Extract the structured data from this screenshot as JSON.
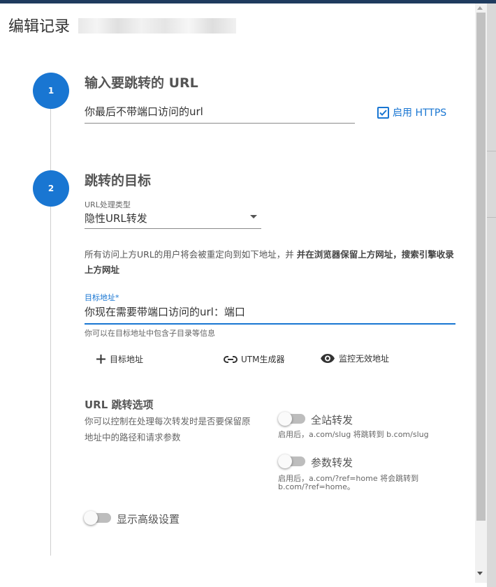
{
  "dialog": {
    "title": "编辑记录"
  },
  "step1": {
    "number": "1",
    "title": "输入要跳转的 URL",
    "url_value": "你最后不带端口访问的url",
    "https_label": "启用 HTTPS",
    "https_checked": true
  },
  "step2": {
    "number": "2",
    "title": "跳转的目标",
    "type_label": "URL处理类型",
    "type_value": "隐性URL转发",
    "description_plain": "所有访问上方URL的用户将会被重定向到如下地址，并 ",
    "description_bold": "并在浏览器保留上方网址，搜索引擎收录上方网址",
    "target_label": "目标地址*",
    "target_value": "你现在需要带端口访问的url：端口",
    "target_hint": "你可以在目标地址中包含子目录等信息",
    "actions": {
      "add_target": "目标地址",
      "utm_builder": "UTM生成器",
      "monitor_invalid": "监控无效地址"
    },
    "options": {
      "title": "URL 跳转选项",
      "description": "你可以控制在处理每次转发时是否要保留原地址中的路径和请求参数",
      "site_forward": {
        "label": "全站转发",
        "hint": "启用后，a.com/slug 将跳转到 b.com/slug",
        "enabled": false
      },
      "param_forward": {
        "label": "参数转发",
        "hint_line1": "启用后，a.com/?ref=home 将会跳转到",
        "hint_line2": "b.com/?ref=home。",
        "enabled": false
      }
    },
    "advanced": {
      "label": "显示高级设置",
      "enabled": false
    }
  },
  "colors": {
    "primary": "#1976d2",
    "header_band": "#1f3b5e",
    "toggle_off": "#bdbdbd"
  }
}
